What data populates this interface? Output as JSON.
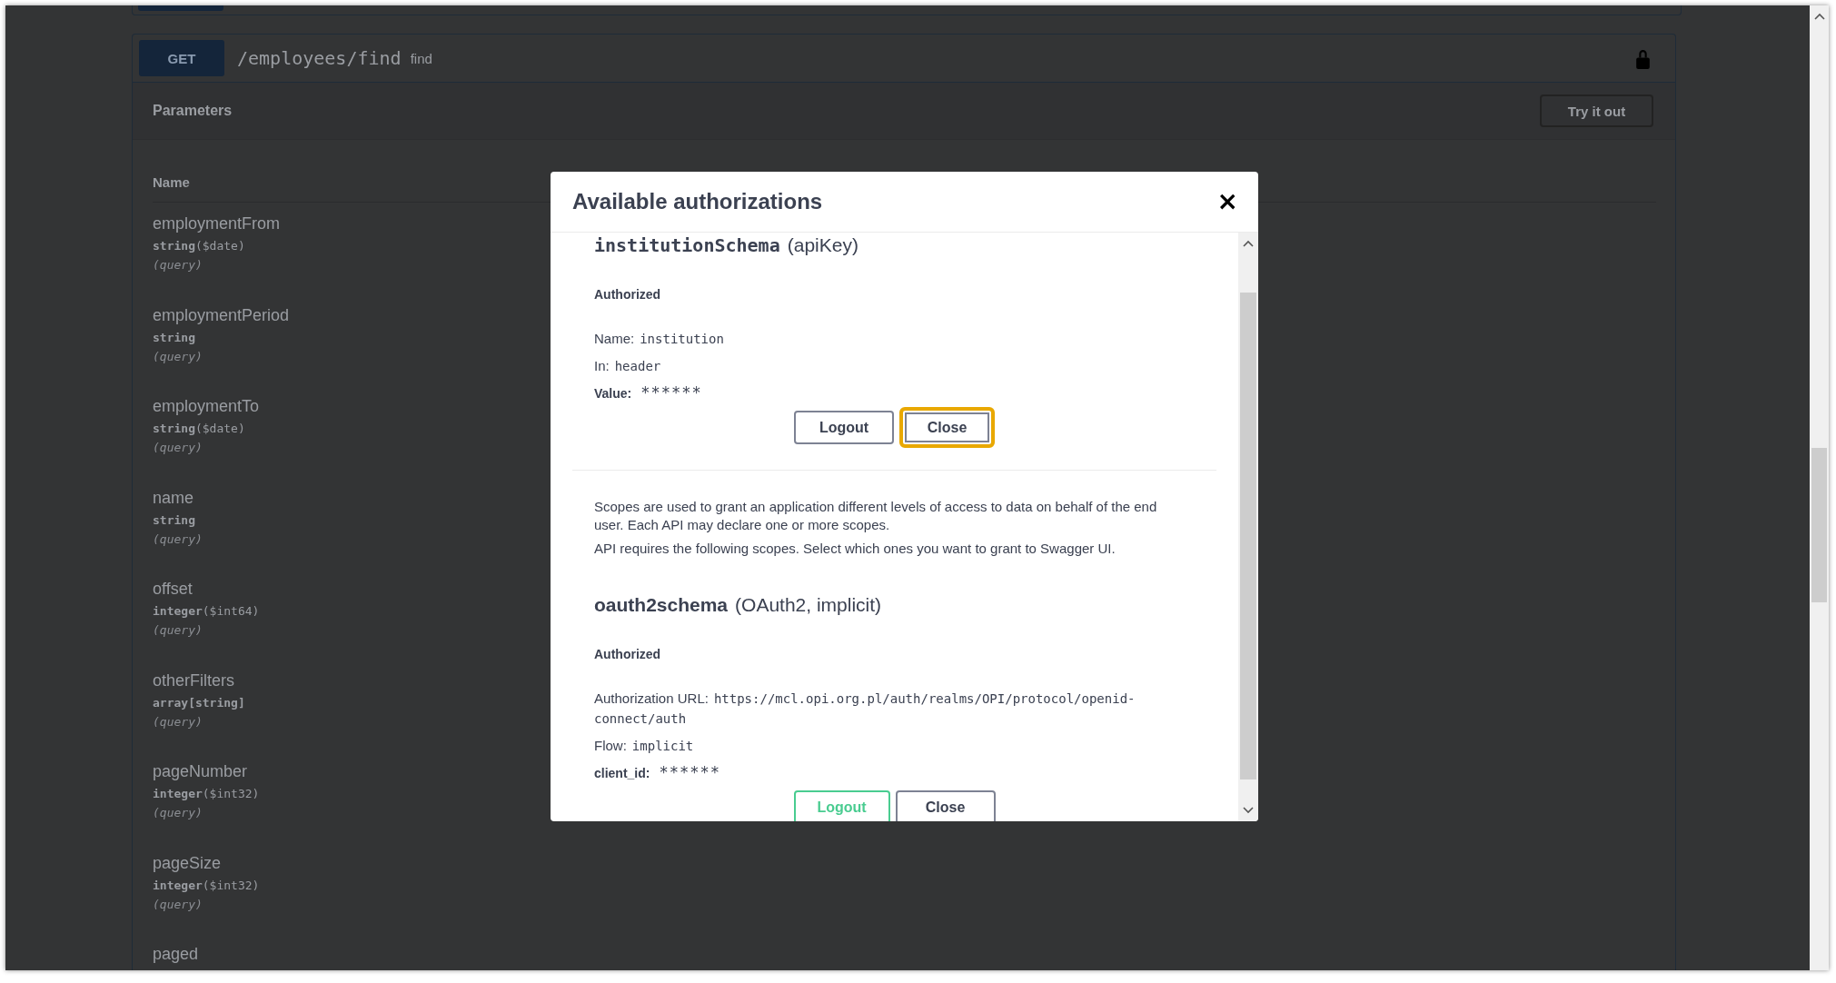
{
  "operation": {
    "method": "GET",
    "path": "/employees/find",
    "summary": "find",
    "locked": true
  },
  "parameters": {
    "title": "Parameters",
    "try_button": "Try it out",
    "column": "Name",
    "items": [
      {
        "name": "employmentFrom",
        "type": "string",
        "format": "($date)",
        "in": "(query)"
      },
      {
        "name": "employmentPeriod",
        "type": "string",
        "in": "(query)"
      },
      {
        "name": "employmentTo",
        "type": "string",
        "format": "($date)",
        "in": "(query)"
      },
      {
        "name": "name",
        "type": "string",
        "in": "(query)"
      },
      {
        "name": "offset",
        "type": "integer",
        "format": "($int64)",
        "in": "(query)"
      },
      {
        "name": "otherFilters",
        "type": "array[string]",
        "in": "(query)"
      },
      {
        "name": "pageNumber",
        "type": "integer",
        "format": "($int32)",
        "in": "(query)"
      },
      {
        "name": "pageSize",
        "type": "integer",
        "format": "($int32)",
        "in": "(query)"
      },
      {
        "name": "paged"
      }
    ]
  },
  "modal": {
    "title": "Available authorizations",
    "close": "×",
    "sections": [
      {
        "name": "institutionSchema",
        "type": "(apiKey)",
        "name_mono": true,
        "status": "Authorized",
        "fields": [
          {
            "kind": "plain",
            "label": "Name:",
            "value": "institution"
          },
          {
            "kind": "plain",
            "label": "In:",
            "value": "header"
          },
          {
            "kind": "secret",
            "label": "Value:",
            "value": "******"
          }
        ],
        "buttons": [
          {
            "label": "Logout",
            "kind": "plain",
            "focused": false
          },
          {
            "label": "Close",
            "kind": "plain",
            "focused": true
          }
        ]
      },
      {
        "name": "oauth2schema",
        "type": "(OAuth2, implicit)",
        "name_mono": false,
        "status": "Authorized",
        "description": [
          "Scopes are used to grant an application different levels of access to data on behalf of the end user. Each API may declare one or more scopes.",
          "API requires the following scopes. Select which ones you want to grant to Swagger UI."
        ],
        "fields": [
          {
            "kind": "plain",
            "label": "Authorization URL:",
            "value": "https://mcl.opi.org.pl/auth/realms/OPI/protocol/openid-connect/auth"
          },
          {
            "kind": "plain",
            "label": "Flow:",
            "value": "implicit"
          },
          {
            "kind": "secret",
            "label": "client_id:",
            "value": "******"
          }
        ],
        "buttons": [
          {
            "label": "Logout",
            "kind": "authorize",
            "focused": false
          },
          {
            "label": "Close",
            "kind": "plain",
            "focused": false
          }
        ]
      }
    ]
  }
}
